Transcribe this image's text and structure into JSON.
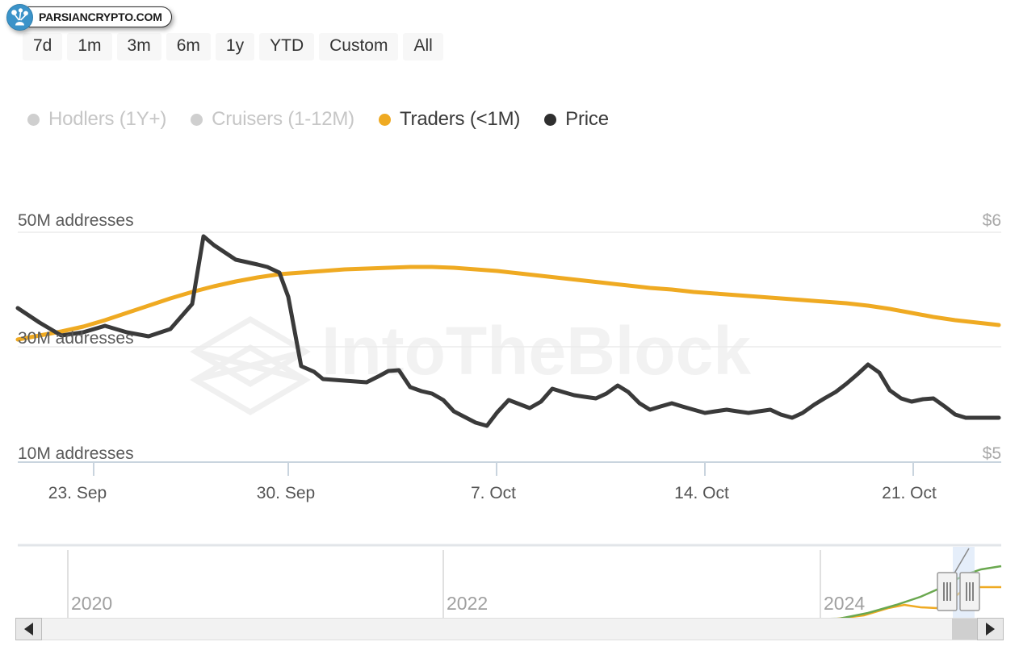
{
  "branding": {
    "watermark_text": "PARSIANCRYPTO.COM",
    "logo_icon": "parsian-crypto-logo-icon",
    "logo_color": "#3b93c9",
    "chart_watermark_text": "IntoTheBlock",
    "chart_watermark_icon": "intotheblock-cube-icon"
  },
  "range_selector": {
    "buttons": [
      {
        "label": "7d",
        "selected": false
      },
      {
        "label": "1m",
        "selected": false
      },
      {
        "label": "3m",
        "selected": false
      },
      {
        "label": "6m",
        "selected": false
      },
      {
        "label": "1y",
        "selected": false
      },
      {
        "label": "YTD",
        "selected": false
      },
      {
        "label": "Custom",
        "selected": false
      },
      {
        "label": "All",
        "selected": false
      }
    ]
  },
  "legend": {
    "items": [
      {
        "label": "Hodlers (1Y+)",
        "color": "#cfcfcf",
        "active": false
      },
      {
        "label": "Cruisers (1-12M)",
        "color": "#cfcfcf",
        "active": false
      },
      {
        "label": "Traders (<1M)",
        "color": "#efaa22",
        "active": true
      },
      {
        "label": "Price",
        "color": "#2f2f2f",
        "active": true
      }
    ]
  },
  "chart_data": {
    "type": "line",
    "title": "",
    "subtitle": "",
    "xlabel": "",
    "ylabel": "addresses",
    "y2label": "Price",
    "grid": true,
    "legend_position": "top-left",
    "y_ticks": [
      "50M addresses",
      "30M addresses",
      "10M addresses"
    ],
    "y_tick_values": [
      50000000,
      30000000,
      10000000
    ],
    "ylim": [
      10000000,
      50000000
    ],
    "y2_ticks": [
      "$6",
      "$5"
    ],
    "y2_tick_values": [
      6,
      5
    ],
    "y2lim": [
      5,
      6
    ],
    "x_ticks": [
      "23. Sep",
      "30. Sep",
      "7. Oct",
      "14. Oct",
      "21. Oct"
    ],
    "series": [
      {
        "name": "Traders (<1M)",
        "color": "#efaa22",
        "axis": "left",
        "unit": "addresses",
        "values": [
          30.6,
          31.0,
          31.5,
          32.1,
          32.8,
          33.6,
          34.5,
          35.4,
          36.2,
          36.9,
          37.5,
          38.0,
          38.4,
          38.7,
          38.9,
          39.1,
          39.2,
          39.3,
          39.4,
          39.4,
          39.3,
          39.1,
          38.9,
          38.6,
          38.3,
          38.0,
          37.7,
          37.4,
          37.1,
          36.8,
          36.6,
          36.3,
          36.1,
          35.9,
          35.7,
          35.5,
          35.3,
          35.1,
          34.9,
          34.6,
          34.2,
          33.7,
          33.2,
          32.8,
          32.5,
          32.2
        ]
      },
      {
        "name": "Price",
        "color": "#3a3a3a",
        "axis": "right",
        "unit": "USD",
        "values": [
          5.62,
          5.58,
          5.54,
          5.55,
          5.57,
          5.55,
          5.54,
          5.56,
          5.63,
          5.73,
          5.82,
          5.95,
          5.89,
          5.85,
          5.83,
          5.8,
          5.72,
          5.42,
          5.3,
          5.29,
          5.27,
          5.28,
          5.33,
          5.31,
          5.2,
          5.18,
          5.17,
          5.12,
          5.09,
          5.14,
          5.2,
          5.17,
          5.14,
          5.19,
          5.26,
          5.22,
          5.21,
          5.2,
          5.24,
          5.31,
          5.24,
          5.16,
          5.17,
          5.12,
          5.11,
          5.11
        ]
      }
    ]
  },
  "navigator": {
    "year_labels": [
      "2020",
      "2022",
      "2024"
    ],
    "series_colors": [
      "#efaa22",
      "#6aa84f",
      "#1e62d0"
    ],
    "selected_range_start": 1180,
    "selected_range_end": 1207,
    "left_handle": "navigator-handle-left",
    "right_handle": "navigator-handle-right"
  },
  "scrollbar": {
    "left_arrow": "scroll-left-arrow-icon",
    "right_arrow": "scroll-right-arrow-icon"
  }
}
